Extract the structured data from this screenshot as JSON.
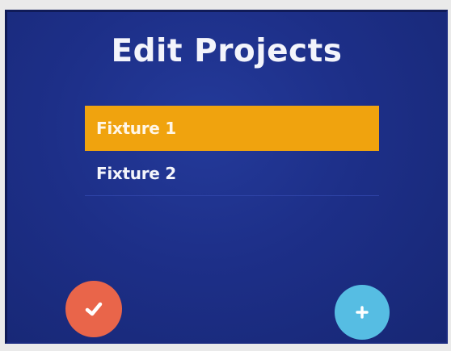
{
  "screen": {
    "title": "Edit Projects"
  },
  "projects": [
    {
      "label": "Fixture 1",
      "selected": true
    },
    {
      "label": "Fixture 2",
      "selected": false
    }
  ],
  "actions": {
    "confirm_icon": "checkmark-icon",
    "add_icon": "plus-icon"
  },
  "colors": {
    "background": "#1d2f88",
    "selected_row": "#f0a30e",
    "confirm_button": "#e9654a",
    "add_button": "#56bde3",
    "text": "#f4f5fb"
  }
}
